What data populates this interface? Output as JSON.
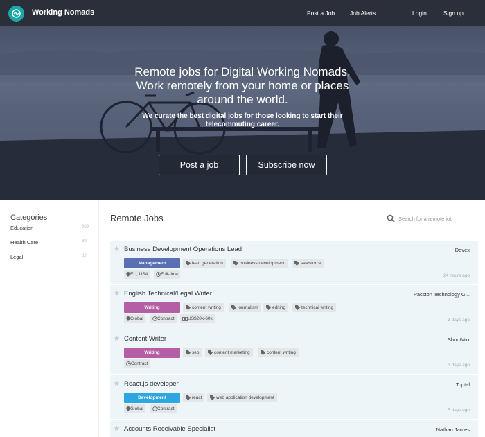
{
  "header": {
    "brand": "Working Nomads",
    "nav": [
      "Post a Job",
      "Job Alerts",
      "Login",
      "Sign up"
    ]
  },
  "hero": {
    "title": "Remote jobs for Digital Working Nomads. Work remotely from your home or places around the world.",
    "subtitle": "We curate the best digital jobs for those looking to start their telecommuting career.",
    "post_button": "Post a job",
    "subscribe_button": "Subscribe now"
  },
  "sidebar": {
    "title": "Categories",
    "items": [
      {
        "label": "Education",
        "count": "309"
      },
      {
        "label": "Health Care",
        "count": "89"
      },
      {
        "label": "Legal",
        "count": "82"
      }
    ]
  },
  "main": {
    "title": "Remote Jobs",
    "search_placeholder": "Search for a remote job"
  },
  "jobs": [
    {
      "title": "Business Development Operations Lead",
      "company": "Devex",
      "category": "Management",
      "category_color": "#5b6fb5",
      "tags": [
        "lead generation",
        "business development",
        "salesforce"
      ],
      "meta": [
        "EU, USA",
        "Full-time"
      ],
      "time": "24 hours ago"
    },
    {
      "title": "English Technical/Legal Writer",
      "company": "Pacston Technology G...",
      "category": "Writing",
      "category_color": "#b45fa5",
      "tags": [
        "content writing",
        "journalism",
        "editing",
        "technical writing"
      ],
      "meta": [
        "Global",
        "Contract",
        "US$20k-60k"
      ],
      "time": "3 days ago"
    },
    {
      "title": "Content Writer",
      "company": "ShoutVox",
      "category": "Writing",
      "category_color": "#b45fa5",
      "tags": [
        "seo",
        "content marketing",
        "content writing"
      ],
      "meta": [
        "Contract"
      ],
      "time": "3 days ago"
    },
    {
      "title": "React.js developer",
      "company": "Toptal",
      "category": "Development",
      "category_color": "#2ea6e0",
      "tags": [
        "react",
        "web application development"
      ],
      "meta": [
        "Global",
        "Contract"
      ],
      "time": "5 days ago"
    },
    {
      "title": "Accounts Receivable Specialist",
      "company": "Nathan James"
    }
  ]
}
